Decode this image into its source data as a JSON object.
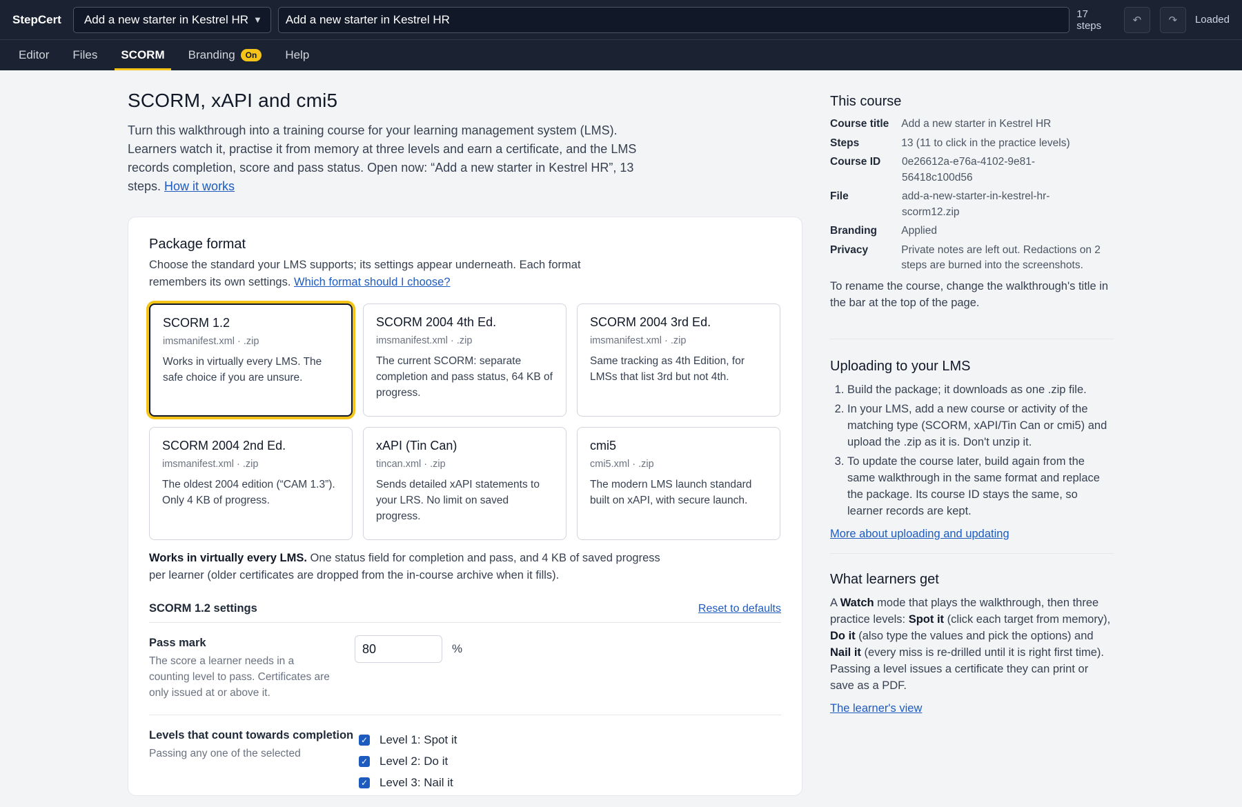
{
  "app": {
    "brand": "StepCert",
    "steps_count": "17 steps",
    "status": "Loaded",
    "undo_icon": "↶",
    "redo_icon": "↷"
  },
  "topbar": {
    "select_value": "Add a new starter in Kestrel HR",
    "title_value": "Add a new starter in Kestrel HR"
  },
  "nav": {
    "editor": "Editor",
    "files": "Files",
    "scorm": "SCORM",
    "branding": "Branding",
    "branding_badge": "On",
    "help": "Help"
  },
  "page": {
    "title": "SCORM, xAPI and cmi5",
    "intro": "Turn this walkthrough into a training course for your learning management system (LMS). Learners watch it, practise it from memory at three levels and earn a certificate, and the LMS records completion, score and pass status. Open now: “Add a new starter in Kestrel HR”, 13 steps.",
    "intro_link": "How it works"
  },
  "package": {
    "heading": "Package format",
    "desc": "Choose the standard your LMS supports; its settings appear underneath. Each format remembers its own settings.",
    "desc_link": "Which format should I choose?",
    "formats": [
      {
        "name": "SCORM 1.2",
        "file": "imsmanifest.xml · .zip",
        "desc": "Works in virtually every LMS. The safe choice if you are unsure."
      },
      {
        "name": "SCORM 2004 4th Ed.",
        "file": "imsmanifest.xml · .zip",
        "desc": "The current SCORM: separate completion and pass status, 64 KB of progress."
      },
      {
        "name": "SCORM 2004 3rd Ed.",
        "file": "imsmanifest.xml · .zip",
        "desc": "Same tracking as 4th Edition, for LMSs that list 3rd but not 4th."
      },
      {
        "name": "SCORM 2004 2nd Ed.",
        "file": "imsmanifest.xml · .zip",
        "desc": "The oldest 2004 edition (“CAM 1.3”). Only 4 KB of progress."
      },
      {
        "name": "xAPI (Tin Can)",
        "file": "tincan.xml · .zip",
        "desc": "Sends detailed xAPI statements to your LRS. No limit on saved progress."
      },
      {
        "name": "cmi5",
        "file": "cmi5.xml · .zip",
        "desc": "The modern LMS launch standard built on xAPI, with secure launch."
      }
    ],
    "summary_bold": "Works in virtually every LMS.",
    "summary_rest": " One status field for completion and pass, and 4 KB of saved progress per learner (older certificates are dropped from the in-course archive when it fills)."
  },
  "settings": {
    "heading": "SCORM 1.2 settings",
    "reset": "Reset to defaults",
    "pass_label": "Pass mark",
    "pass_help": "The score a learner needs in a counting level to pass. Certificates are only issued at or above it.",
    "pass_value": "80",
    "pass_unit": "%",
    "levels_label": "Levels that count towards completion",
    "levels_help": "Passing any one of the selected",
    "levels": [
      "Level 1: Spot it",
      "Level 2: Do it",
      "Level 3: Nail it"
    ],
    "check_mark": "✓"
  },
  "side": {
    "course_heading": "This course",
    "course": {
      "title_k": "Course title",
      "title_v": "Add a new starter in Kestrel HR",
      "steps_k": "Steps",
      "steps_v": "13 (11 to click in the practice levels)",
      "id_k": "Course ID",
      "id_v": "0e26612a-e76a-4102-9e81-56418c100d56",
      "file_k": "File",
      "file_v": "add-a-new-starter-in-kestrel-hr-scorm12.zip",
      "branding_k": "Branding",
      "branding_v": "Applied",
      "privacy_k": "Privacy",
      "privacy_v": "Private notes are left out. Redactions on 2 steps are burned into the screenshots."
    },
    "rename_note": "To rename the course, change the walkthrough's title in the bar at the top of the page.",
    "upload_heading": "Uploading to your LMS",
    "upload_steps": [
      "Build the package; it downloads as one .zip file.",
      "In your LMS, add a new course or activity of the matching type (SCORM, xAPI/Tin Can or cmi5) and upload the .zip as it is. Don't unzip it.",
      "To update the course later, build again from the same walkthrough in the same format and replace the package. Its course ID stays the same, so learner records are kept."
    ],
    "upload_link": "More about uploading and updating",
    "learners_heading": "What learners get",
    "learners_t1": "A ",
    "learners_b1": "Watch",
    "learners_t2": " mode that plays the walkthrough, then three practice levels: ",
    "learners_b2": "Spot it",
    "learners_t3": " (click each target from memory), ",
    "learners_b3": "Do it",
    "learners_t4": " (also type the values and pick the options) and ",
    "learners_b4": "Nail it",
    "learners_t5": " (every miss is re-drilled until it is right first time). Passing a level issues a certificate they can print or save as a PDF.",
    "learners_link": "The learner's view"
  }
}
